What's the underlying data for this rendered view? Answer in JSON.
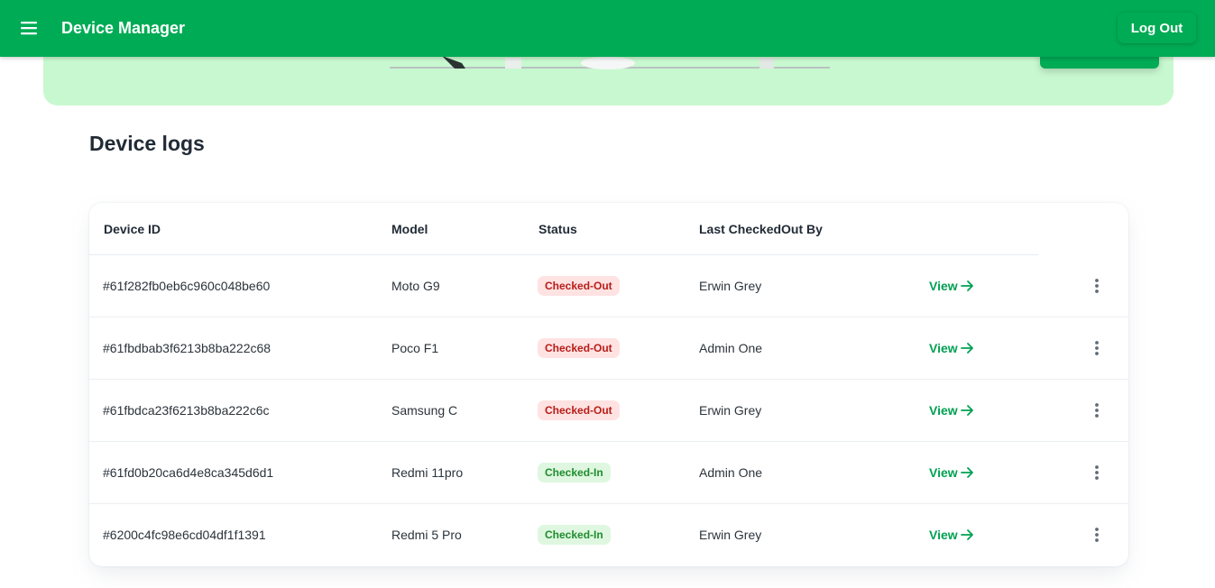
{
  "header": {
    "menu_icon": "hamburger-menu-icon",
    "title": "Device Manager",
    "logout_label": "Log Out"
  },
  "colors": {
    "brand_green": "#00ab55",
    "hero_bg": "#c8f8d0",
    "checked_out_bg": "#ffe2e2",
    "checked_out_text": "#b71d18",
    "checked_in_bg": "#dff7e0",
    "checked_in_text": "#1f8c2e"
  },
  "main": {
    "heading": "Device logs",
    "table": {
      "columns": [
        "Device ID",
        "Model",
        "Status",
        "Last CheckedOut By"
      ],
      "view_label": "View",
      "view_icon": "arrow-right-icon",
      "more_icon": "more-vertical-icon",
      "rows": [
        {
          "device_id": "#61f282fb0eb6c960c048be60",
          "model": "Moto G9",
          "status": "Checked-Out",
          "last_by": "Erwin Grey"
        },
        {
          "device_id": "#61fbdbab3f6213b8ba222c68",
          "model": "Poco F1",
          "status": "Checked-Out",
          "last_by": "Admin One"
        },
        {
          "device_id": "#61fbdca23f6213b8ba222c6c",
          "model": "Samsung C",
          "status": "Checked-Out",
          "last_by": "Erwin Grey"
        },
        {
          "device_id": "#61fd0b20ca6d4e8ca345d6d1",
          "model": "Redmi 11pro",
          "status": "Checked-In",
          "last_by": "Admin One"
        },
        {
          "device_id": "#6200c4fc98e6cd04df1f1391",
          "model": "Redmi 5 Pro",
          "status": "Checked-In",
          "last_by": "Erwin Grey"
        }
      ]
    }
  }
}
